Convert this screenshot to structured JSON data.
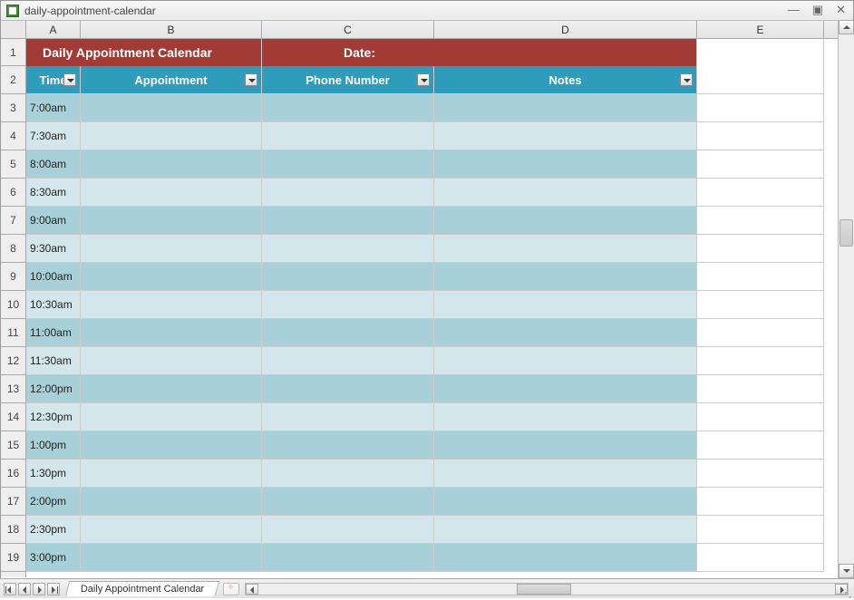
{
  "window": {
    "title": "daily-appointment-calendar"
  },
  "columns": {
    "letters": [
      "A",
      "B",
      "C",
      "D",
      "E"
    ],
    "widths": [
      60,
      200,
      190,
      290,
      140
    ]
  },
  "banner": {
    "title": "Daily Appointment Calendar",
    "date_label": "Date:"
  },
  "headers": {
    "time": "Time",
    "appointment": "Appointment",
    "phone": "Phone Number",
    "notes": "Notes"
  },
  "rows": [
    {
      "num": 1
    },
    {
      "num": 2
    },
    {
      "num": 3,
      "time": "7:00am"
    },
    {
      "num": 4,
      "time": "7:30am"
    },
    {
      "num": 5,
      "time": "8:00am"
    },
    {
      "num": 6,
      "time": "8:30am"
    },
    {
      "num": 7,
      "time": "9:00am"
    },
    {
      "num": 8,
      "time": "9:30am"
    },
    {
      "num": 9,
      "time": "10:00am"
    },
    {
      "num": 10,
      "time": "10:30am"
    },
    {
      "num": 11,
      "time": "11:00am"
    },
    {
      "num": 12,
      "time": "11:30am"
    },
    {
      "num": 13,
      "time": "12:00pm"
    },
    {
      "num": 14,
      "time": "12:30pm"
    },
    {
      "num": 15,
      "time": "1:00pm"
    },
    {
      "num": 16,
      "time": "1:30pm"
    },
    {
      "num": 17,
      "time": "2:00pm"
    },
    {
      "num": 18,
      "time": "2:30pm"
    },
    {
      "num": 19,
      "time": "3:00pm"
    }
  ],
  "sheet_tab": {
    "name": "Daily Appointment Calendar"
  }
}
